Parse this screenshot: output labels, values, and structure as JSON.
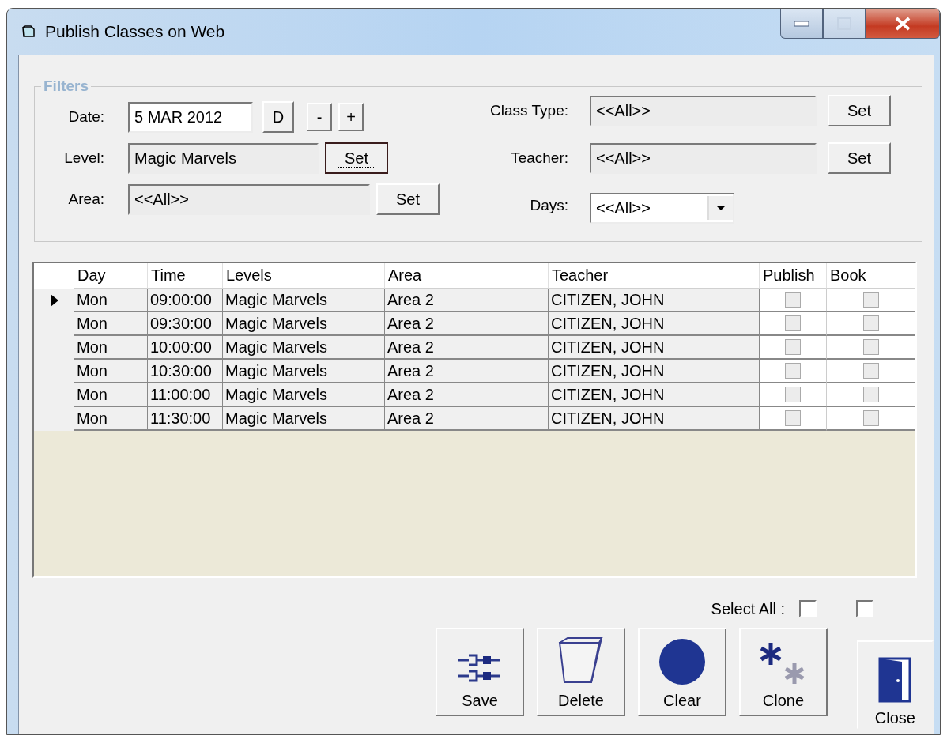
{
  "window": {
    "title": "Publish Classes on Web",
    "maximize_disabled": true
  },
  "filters": {
    "title": "Filters",
    "left": [
      {
        "kind": "date",
        "label": "Date:",
        "value": "5 MAR 2012",
        "buttons": [
          "D",
          "-",
          "+"
        ]
      },
      {
        "kind": "set",
        "label": "Level:",
        "value": "Magic Marvels",
        "button": "Set",
        "focused": true
      },
      {
        "kind": "set",
        "label": "Area:",
        "value": "<<All>>",
        "button": "Set",
        "focused": false
      }
    ],
    "right": [
      {
        "kind": "set",
        "label": "Class Type:",
        "value": "<<All>>",
        "button": "Set",
        "focused": false
      },
      {
        "kind": "set",
        "label": "Teacher:",
        "value": "<<All>>",
        "button": "Set",
        "focused": false
      },
      {
        "kind": "combo",
        "label": "Days:",
        "value": "<<All>>"
      }
    ]
  },
  "grid": {
    "columns": [
      "Day",
      "Time",
      "Levels",
      "Area",
      "Teacher",
      "Publish",
      "Book"
    ],
    "rows": [
      {
        "current": true,
        "day": "Mon",
        "time": "09:00:00",
        "level": "Magic Marvels",
        "area": "Area 2",
        "teacher": "CITIZEN, JOHN",
        "publish": false,
        "book": false
      },
      {
        "current": false,
        "day": "Mon",
        "time": "09:30:00",
        "level": "Magic Marvels",
        "area": "Area 2",
        "teacher": "CITIZEN, JOHN",
        "publish": false,
        "book": false
      },
      {
        "current": false,
        "day": "Mon",
        "time": "10:00:00",
        "level": "Magic Marvels",
        "area": "Area 2",
        "teacher": "CITIZEN, JOHN",
        "publish": false,
        "book": false
      },
      {
        "current": false,
        "day": "Mon",
        "time": "10:30:00",
        "level": "Magic Marvels",
        "area": "Area 2",
        "teacher": "CITIZEN, JOHN",
        "publish": false,
        "book": false
      },
      {
        "current": false,
        "day": "Mon",
        "time": "11:00:00",
        "level": "Magic Marvels",
        "area": "Area 2",
        "teacher": "CITIZEN, JOHN",
        "publish": false,
        "book": false
      },
      {
        "current": false,
        "day": "Mon",
        "time": "11:30:00",
        "level": "Magic Marvels",
        "area": "Area 2",
        "teacher": "CITIZEN, JOHN",
        "publish": false,
        "book": false
      }
    ]
  },
  "select_all": {
    "label": "Select All :",
    "publish": false,
    "book": false
  },
  "buttons": [
    {
      "kind": "save",
      "label": "Save"
    },
    {
      "kind": "delete",
      "label": "Delete"
    },
    {
      "kind": "clear",
      "label": "Clear"
    },
    {
      "kind": "clone",
      "label": "Clone"
    }
  ],
  "close_button": {
    "label": "Close"
  }
}
